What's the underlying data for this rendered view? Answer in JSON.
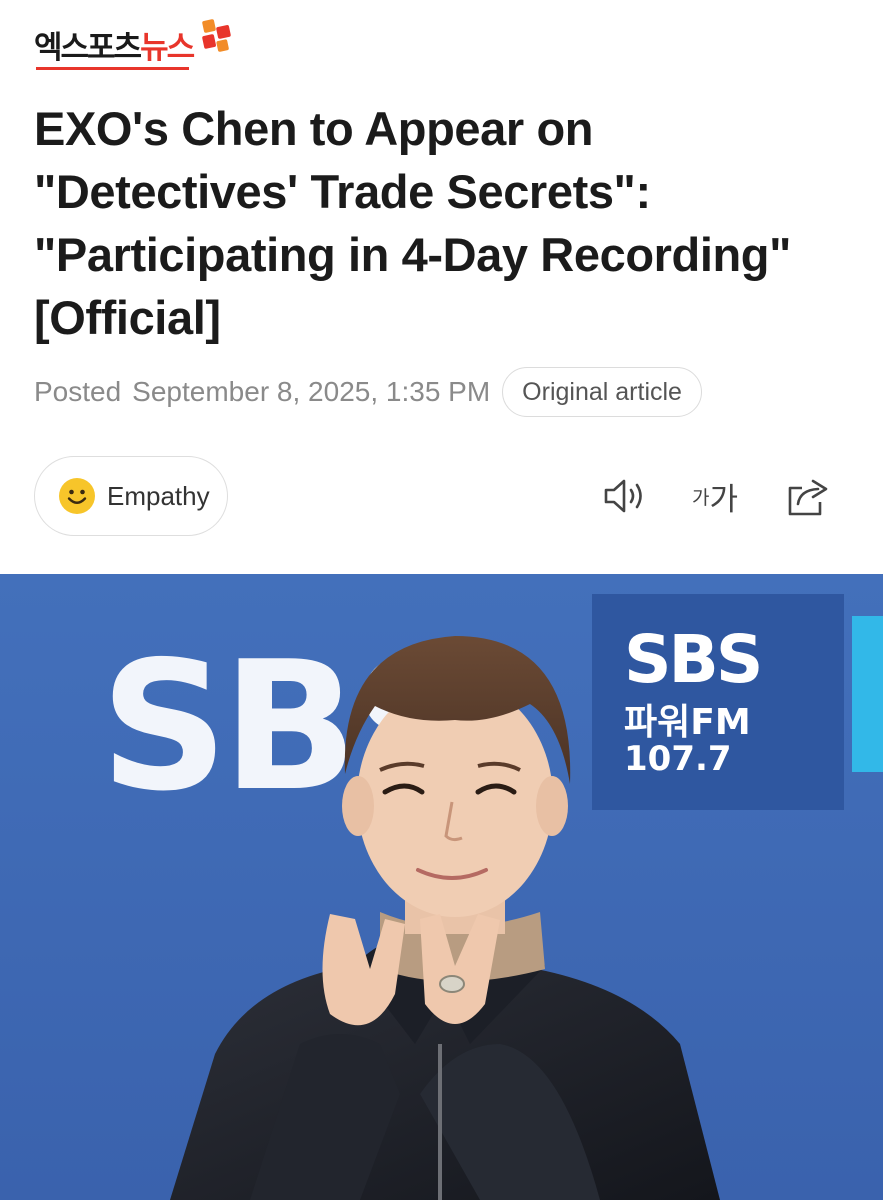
{
  "publisher": {
    "logo_text_dark": "엑스포츠",
    "logo_text_red": "뉴스",
    "logo_mark_colors": [
      "#e8352b",
      "#f28c28"
    ]
  },
  "article": {
    "title_lines": [
      "EXO's Chen to Appear on",
      "\"Detectives' Trade Secrets\":",
      "\"Participating in 4-Day Recording\"",
      "[Official]"
    ],
    "posted_label": "Posted",
    "posted_date": "September 8, 2025, 1:35 PM",
    "original_article_label": "Original article"
  },
  "actions": {
    "empathy_label": "Empathy",
    "empathy_icon": "smiley-face-icon",
    "font_size_small": "가",
    "font_size_large": "가",
    "listen_icon": "speaker-icon",
    "share_icon": "share-icon"
  },
  "photo": {
    "backdrop_large_text": "SBS",
    "panel_line1": "SBS",
    "panel_line2": "파워FM",
    "panel_line3": "107.7",
    "backdrop_color": "#3f68b4"
  }
}
